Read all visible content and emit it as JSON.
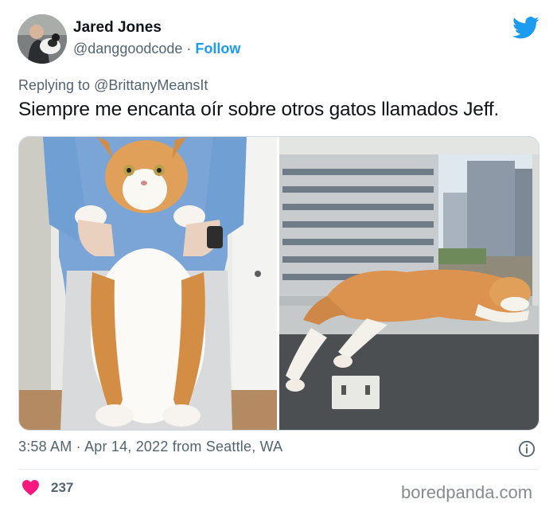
{
  "author": {
    "name": "Jared Jones",
    "handle": "@danggoodcode",
    "separator": "·",
    "follow_label": "Follow"
  },
  "brand_icon": "twitter-bird-icon",
  "reply": {
    "prefix": "Replying to",
    "mention": "@BrittanyMeansIt"
  },
  "tweet_text": "Siempre me encanta oír sobre otros gatos llamados Jeff.",
  "media": {
    "count": 2,
    "items": [
      {
        "icon": "cat-held-photo"
      },
      {
        "icon": "cat-on-windowsill-photo"
      }
    ]
  },
  "meta": {
    "time": "3:58 AM",
    "separator": "·",
    "date": "Apr 14, 2022",
    "location": "from Seattle, WA"
  },
  "likes": {
    "count": "237",
    "icon": "heart-icon"
  },
  "info_icon": "info-icon",
  "watermark": "boredpanda.com",
  "colors": {
    "twitter_blue": "#1d9bf0",
    "heart_red": "#f91880",
    "text_primary": "#0f1419",
    "text_secondary": "#536471"
  }
}
